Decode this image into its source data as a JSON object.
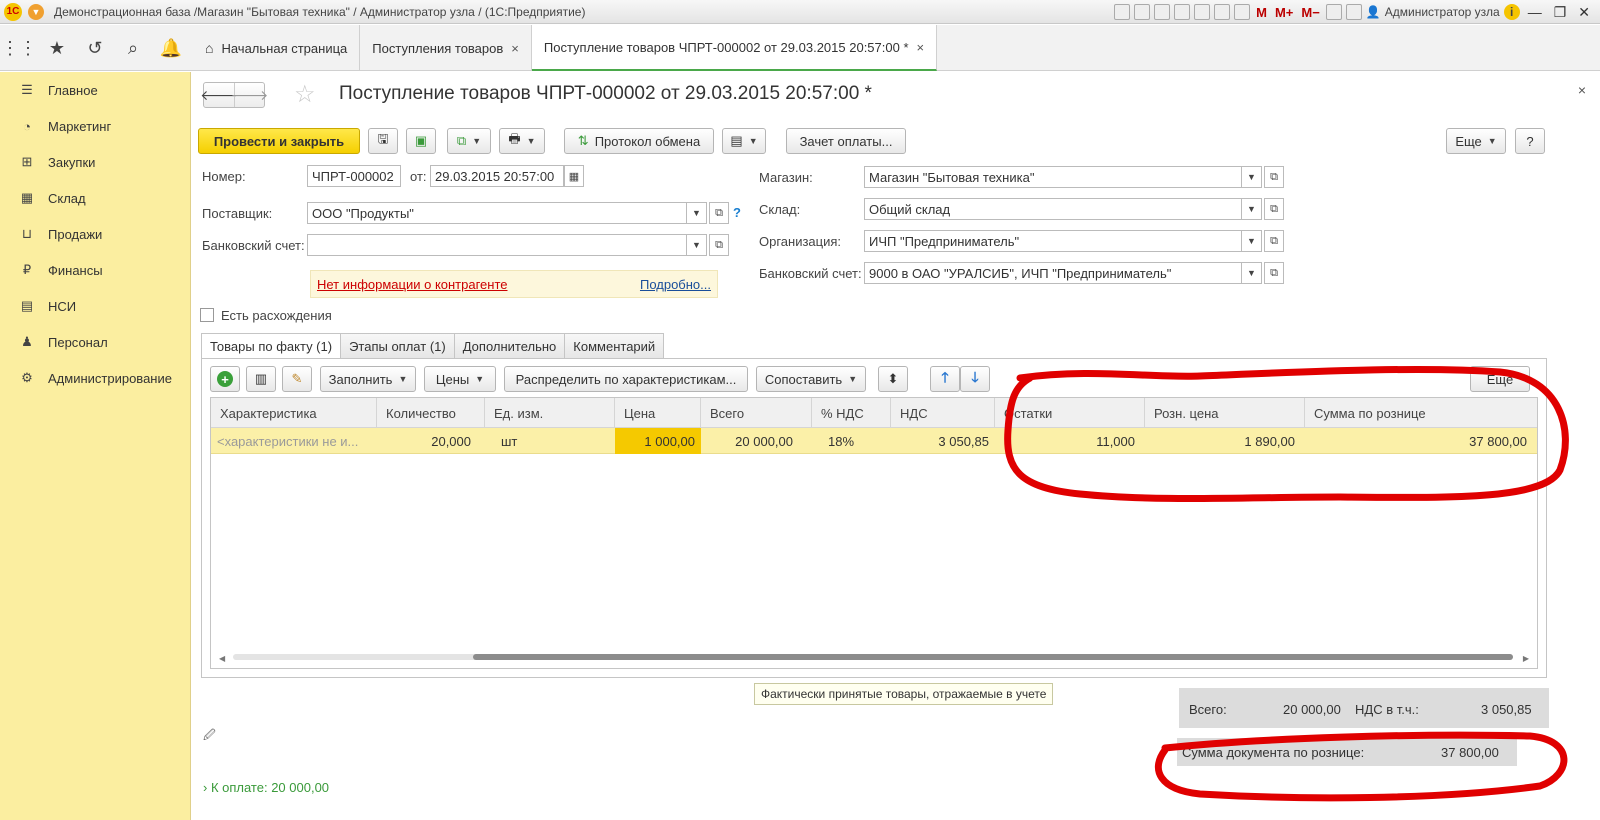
{
  "titlebar": {
    "logo": "1С",
    "title": "Демонстрационная база /Магазин \"Бытовая техника\" / Администратор узла / (1С:Предприятие)",
    "m1": "M",
    "m2": "M+",
    "m3": "M−",
    "user": "Администратор узла",
    "info": "i"
  },
  "toppanel": {
    "tabs": [
      {
        "label": "Начальная страница"
      },
      {
        "label": "Поступления товаров",
        "close": "×"
      },
      {
        "label": "Поступление товаров ЧПРТ-000002 от 29.03.2015 20:57:00 *",
        "close": "×"
      }
    ]
  },
  "sidebar": {
    "items": [
      {
        "label": "Главное",
        "icon": "menu-icon"
      },
      {
        "label": "Маркетинг",
        "icon": "pie-chart-icon"
      },
      {
        "label": "Закупки",
        "icon": "cart-icon"
      },
      {
        "label": "Склад",
        "icon": "warehouse-icon"
      },
      {
        "label": "Продажи",
        "icon": "basket-icon"
      },
      {
        "label": "Финансы",
        "icon": "ruble-icon"
      },
      {
        "label": "НСИ",
        "icon": "catalog-icon"
      },
      {
        "label": "Персонал",
        "icon": "person-icon"
      },
      {
        "label": "Администрирование",
        "icon": "gear-icon"
      }
    ]
  },
  "doc": {
    "title": "Поступление товаров ЧПРТ-000002 от 29.03.2015 20:57:00 *",
    "close": "×"
  },
  "toolbar": {
    "post_close": "Провести и закрыть",
    "exchange": "Протокол обмена",
    "offset": "Зачет оплаты...",
    "more": "Еще",
    "help": "?"
  },
  "form": {
    "number_label": "Номер:",
    "number": "ЧПРТ-000002",
    "date_label": "от:",
    "date": "29.03.2015 20:57:00",
    "supplier_label": "Поставщик:",
    "supplier": "ООО \"Продукты\"",
    "bank_label": "Банковский счет:",
    "bank": "",
    "store_label": "Магазин:",
    "store": "Магазин \"Бытовая техника\"",
    "warehouse_label": "Склад:",
    "warehouse": "Общий склад",
    "org_label": "Организация:",
    "org": "ИЧП \"Предприниматель\"",
    "org_bank_label": "Банковский счет:",
    "org_bank": "9000 в ОАО \"УРАЛСИБ\", ИЧП \"Предприниматель\"",
    "info_text": "Нет информации о контрагенте",
    "info_more": "Подробно...",
    "discrepancy": "Есть расхождения"
  },
  "form_tabs": [
    {
      "label": "Товары по факту (1)"
    },
    {
      "label": "Этапы оплат (1)"
    },
    {
      "label": "Дополнительно"
    },
    {
      "label": "Комментарий"
    }
  ],
  "table_toolbar": {
    "fill": "Заполнить",
    "prices": "Цены",
    "distribute": "Распределить по характеристикам...",
    "compare": "Сопоставить",
    "more": "Еще"
  },
  "table": {
    "columns": [
      "Характеристика",
      "Количество",
      "Ед. изм.",
      "Цена",
      "Всего",
      "% НДС",
      "НДС",
      "Остатки",
      "Розн. цена",
      "Сумма по рознице"
    ],
    "rows": [
      [
        "<характеристики не и...",
        "20,000",
        "шт",
        "1 000,00",
        "20 000,00",
        "18%",
        "3 050,85",
        "11,000",
        "1 890,00",
        "37 800,00"
      ]
    ]
  },
  "footer": {
    "hint": "Фактически принятые товары, отражаемые в учете",
    "total_label": "Всего:",
    "total": "20 000,00",
    "vat_label": "НДС в т.ч.:",
    "vat": "3 050,85",
    "retail_label": "Сумма документа по рознице:",
    "retail": "37 800,00",
    "pay_link": "К оплате: 20 000,00"
  },
  "colors": {
    "sidebar_bg": "#fbeea0",
    "primary_button": "#f5cf00",
    "annotation": "#e00000"
  }
}
